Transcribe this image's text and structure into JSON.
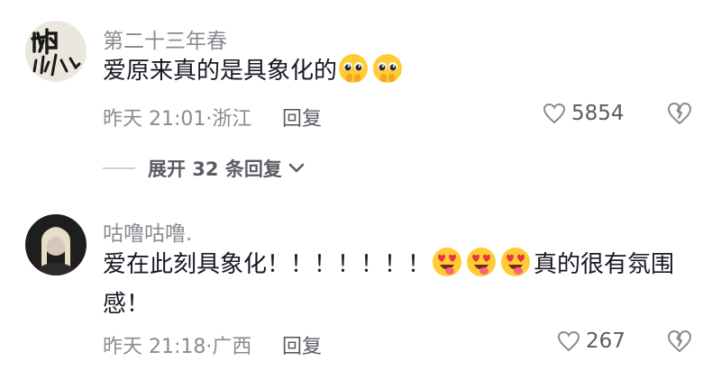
{
  "comments": [
    {
      "username": "第二十三年春",
      "text_before": "爱原来真的是具象化的",
      "text_after": "",
      "emojis": [
        "pleading-face-hands-emoji",
        "pleading-face-hands-emoji"
      ],
      "meta": "昨天 21:01·浙江",
      "reply_label": "回复",
      "likes": "5854"
    },
    {
      "username": "咕噜咕噜.",
      "text_before": "爱在此刻具象化！！！！！！！",
      "text_after": "真的很有氛围感！",
      "emojis": [
        "heart-eyes-tongue-emoji",
        "heart-eyes-tongue-emoji",
        "heart-eyes-tongue-emoji"
      ],
      "meta": "昨天 21:18·广西",
      "reply_label": "回复",
      "likes": "267"
    }
  ],
  "expand_replies": {
    "label": "展开 32 条回复"
  },
  "colors": {
    "text": "#161823",
    "secondary": "#8a8b91",
    "action": "#5b5c63"
  }
}
